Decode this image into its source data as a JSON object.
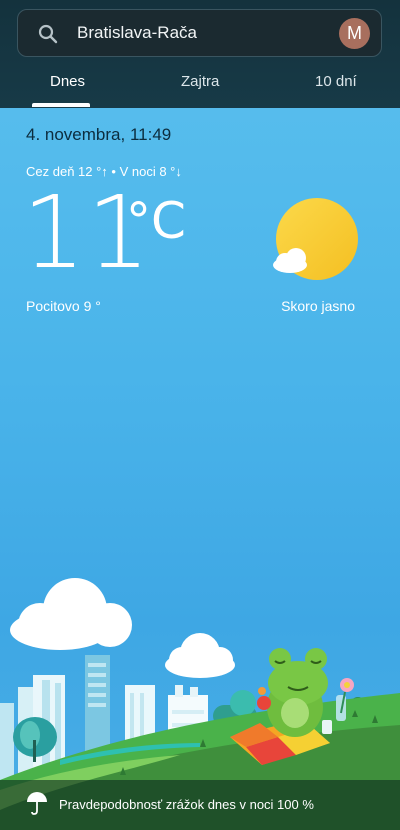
{
  "search": {
    "value": "Bratislava-Rača",
    "icon": "search-icon"
  },
  "account": {
    "initial": "M"
  },
  "tabs": [
    {
      "label": "Dnes",
      "active": true
    },
    {
      "label": "Zajtra",
      "active": false
    },
    {
      "label": "10 dní",
      "active": false
    }
  ],
  "current": {
    "datetime": "4. novembra, 11:49",
    "day_night": "Cez deň 12 °↑ • V noci 8 °↓",
    "temperature": "11",
    "unit": "°C",
    "feels_like": "Pocitovo 9 °",
    "condition": "Skoro jasno",
    "icon": "partly-sunny-icon"
  },
  "precipitation": {
    "text": "Pravdepodobnosť zrážok dnes v noci 100 %",
    "icon": "umbrella-icon"
  },
  "colors": {
    "sky": "#4ab4ea",
    "topbar": "#173a47",
    "sun": "#f8cd33",
    "grass": "#3f8f3c"
  }
}
